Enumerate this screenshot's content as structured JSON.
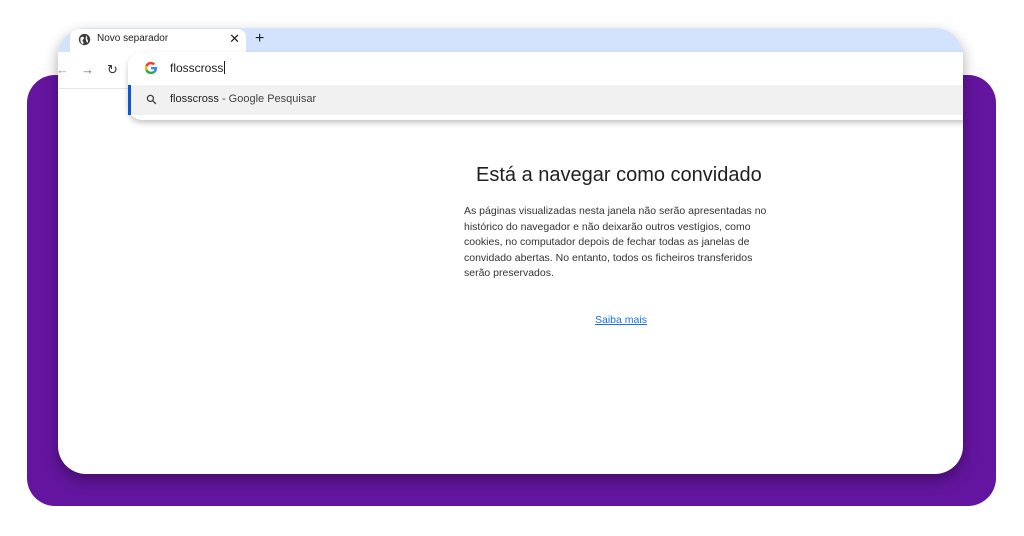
{
  "tab": {
    "title": "Novo separador",
    "close_glyph": "✕",
    "icon": "globe-icon"
  },
  "new_tab_glyph": "+",
  "toolbar": {
    "back_glyph": "←",
    "forward_glyph": "→",
    "reload_glyph": "↻"
  },
  "omnibox": {
    "value": "flosscross",
    "engine_icon": "google-g-icon"
  },
  "suggestion": {
    "query": "flosscross",
    "suffix": " - Google Pesquisar",
    "icon": "search-icon"
  },
  "page": {
    "heading": "Está a navegar como convidado",
    "description": "As páginas visualizadas nesta janela não serão apresentadas no histórico do navegador e não deixarão outros vestígios, como cookies, no computador depois de fechar todas as janelas de convidado abertas. No entanto, todos os ficheiros transferidos serão preservados.",
    "learn_more": "Saiba mais"
  },
  "colors": {
    "frame_purple": "#63159f",
    "tabstrip": "#d3e3fd",
    "accent_blue": "#0b57d0",
    "link": "#1a73e8"
  }
}
